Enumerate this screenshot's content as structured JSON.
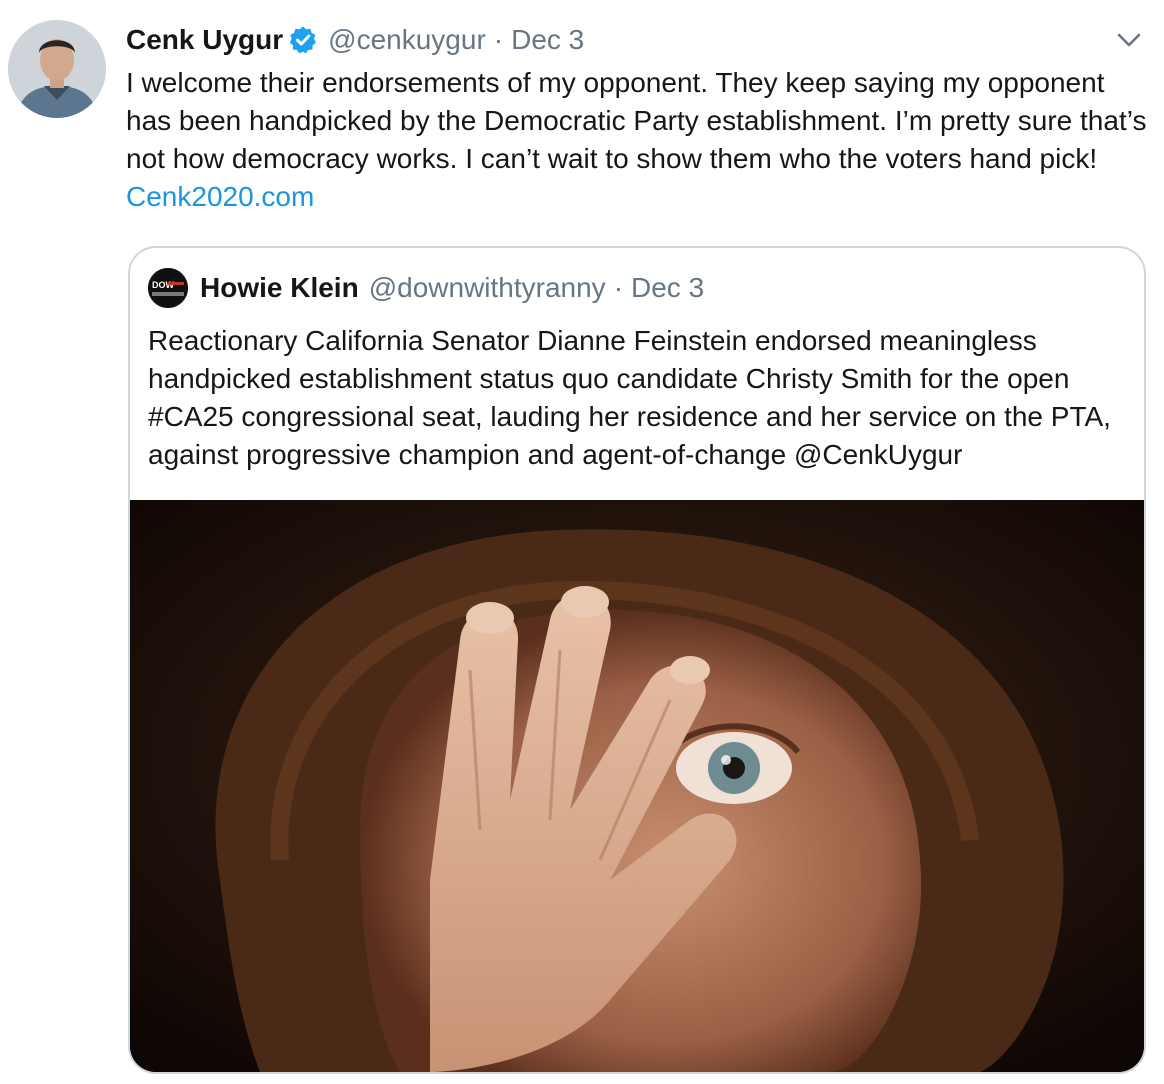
{
  "tweet": {
    "author_name": "Cenk Uygur",
    "handle": "@cenkuygur",
    "separator": "·",
    "date": "Dec 3",
    "text": "I welcome their endorsements of my opponent. They keep saying my opponent has been handpicked by the Democratic Party establishment. I’m pretty sure that’s not how democracy works. I can’t wait to show them who the voters hand pick! ",
    "link_text": "Cenk2020.com",
    "verified_icon": "verified-badge-icon",
    "menu_icon": "chevron-down-icon"
  },
  "quoted_tweet": {
    "author_name": "Howie Klein",
    "handle": "@downwithtyranny",
    "separator": "·",
    "date": "Dec 3",
    "text": "Reactionary California Senator Dianne Feinstein endorsed meaningless handpicked establishment status quo candidate Christy Smith for the open #CA25 congressional seat, lauding her residence and her service on the PTA, against progressive champion and agent-of-change @CenkUygur",
    "avatar_text": "DOW"
  },
  "colors": {
    "text_primary": "#14171a",
    "text_secondary": "#657786",
    "link": "#1b95e0",
    "verified": "#1da1f2",
    "border": "#ccd6dd"
  }
}
